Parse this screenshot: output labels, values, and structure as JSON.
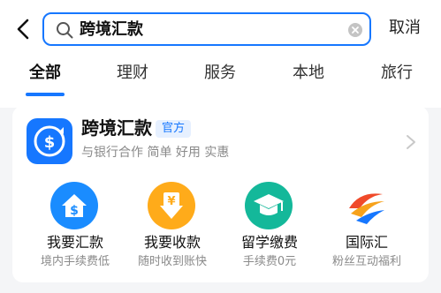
{
  "search": {
    "query": "跨境汇款",
    "cancel_label": "取消"
  },
  "tabs": [
    {
      "label": "全部"
    },
    {
      "label": "理财"
    },
    {
      "label": "服务"
    },
    {
      "label": "本地"
    },
    {
      "label": "旅行"
    }
  ],
  "result": {
    "title": "跨境汇款",
    "badge": "官方",
    "subtitle": "与银行合作 简单 好用 实惠",
    "services": [
      {
        "name": "我要汇款",
        "desc": "境内手续费低",
        "icon": "dollar-house-icon"
      },
      {
        "name": "我要收款",
        "desc": "随时收到账快",
        "icon": "yen-download-icon"
      },
      {
        "name": "留学缴费",
        "desc": "手续费0元",
        "icon": "graduation-cap-icon"
      },
      {
        "name": "国际汇",
        "desc": "粉丝互动福利",
        "icon": "globe-logo-icon"
      }
    ]
  },
  "colors": {
    "accent": "#1677ff",
    "background": "#f4f5f7",
    "muted_text": "#8a8a8a"
  }
}
